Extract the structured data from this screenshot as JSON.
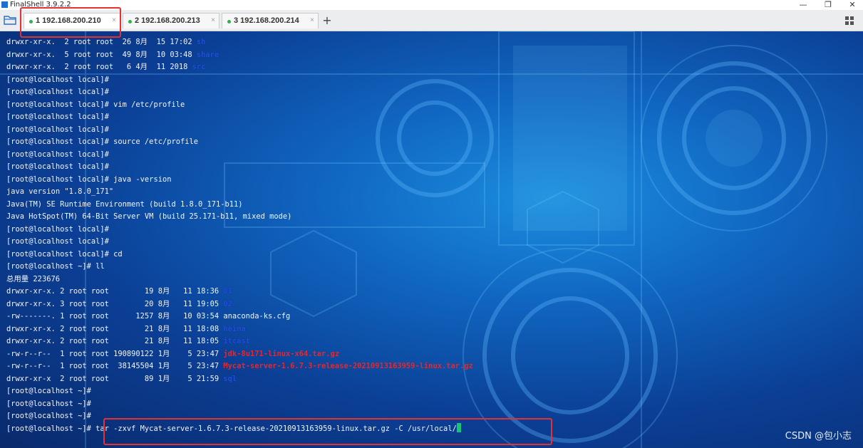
{
  "window": {
    "title": "FinalShell 3.9.2.2",
    "controls": {
      "minimize": "—",
      "maximize": "❐",
      "close": "✕"
    }
  },
  "tabs": [
    {
      "label": "1 192.168.200.210",
      "active": true,
      "status_color": "#2db34a"
    },
    {
      "label": "2 192.168.200.213",
      "active": false,
      "status_color": "#2db34a"
    },
    {
      "label": "3 192.168.200.214",
      "active": false,
      "status_color": "#2db34a"
    }
  ],
  "tab_close_glyph": "×",
  "add_tab_glyph": "+",
  "icons": [
    "folder-icon",
    "grid-icon"
  ],
  "colors": {
    "highlight_box": "#e53131",
    "dir_name": "#1f4fd6",
    "archive_name": "#e8262a",
    "cursor": "#19c27a"
  },
  "terminal": {
    "lines": [
      {
        "text": "drwxr-xr-x.  2 root root  26 8月  15 17:02 ",
        "name": "sh"
      },
      {
        "text": "drwxr-xr-x.  5 root root  49 8月  10 03:48 ",
        "name": "share"
      },
      {
        "text": "drwxr-xr-x.  2 root root   6 4月  11 2018 ",
        "name": "src"
      },
      {
        "text": "[root@localhost local]# "
      },
      {
        "text": "[root@localhost local]# "
      },
      {
        "text": "[root@localhost local]# vim /etc/profile"
      },
      {
        "text": "[root@localhost local]# "
      },
      {
        "text": "[root@localhost local]# "
      },
      {
        "text": "[root@localhost local]# source /etc/profile"
      },
      {
        "text": "[root@localhost local]# "
      },
      {
        "text": "[root@localhost local]# "
      },
      {
        "text": "[root@localhost local]# java -version"
      },
      {
        "text": "java version \"1.8.0_171\""
      },
      {
        "text": "Java(TM) SE Runtime Environment (build 1.8.0_171-b11)"
      },
      {
        "text": "Java HotSpot(TM) 64-Bit Server VM (build 25.171-b11, mixed mode)"
      },
      {
        "text": "[root@localhost local]# "
      },
      {
        "text": "[root@localhost local]# "
      },
      {
        "text": "[root@localhost local]# cd"
      },
      {
        "text": "[root@localhost ~]# ll"
      },
      {
        "text": "总用量 223676"
      },
      {
        "text": "drwxr-xr-x. 2 root root        19 8月   11 18:36 ",
        "name": "01"
      },
      {
        "text": "drwxr-xr-x. 3 root root        20 8月   11 19:05 ",
        "name": "02"
      },
      {
        "text": "-rw-------. 1 root root      1257 8月   10 03:54 anaconda-ks.cfg"
      },
      {
        "text": "drwxr-xr-x. 2 root root        21 8月   11 18:08 ",
        "name": "heima"
      },
      {
        "text": "drwxr-xr-x. 2 root root        21 8月   11 18:05 ",
        "name": "itcast"
      },
      {
        "text": "-rw-r--r--  1 root root 190890122 1月    5 23:47 ",
        "archive": "jdk-8u171-linux-x64.tar.gz"
      },
      {
        "text": "-rw-r--r--  1 root root  38145504 1月    5 23:47 ",
        "archive": "Mycat-server-1.6.7.3-release-20210913163959-linux.tar.gz"
      },
      {
        "text": "drwxr-xr-x  2 root root        89 1月    5 21:59 ",
        "name": "sql"
      },
      {
        "text": "[root@localhost ~]# "
      },
      {
        "text": "[root@localhost ~]# "
      },
      {
        "text": "[root@localhost ~]# "
      },
      {
        "text": "[root@localhost ~]# tar -zxvf Mycat-server-1.6.7.3-release-20210913163959-linux.tar.gz -C /usr/local/",
        "cursor": true
      }
    ]
  },
  "watermark": "CSDN @包小志"
}
